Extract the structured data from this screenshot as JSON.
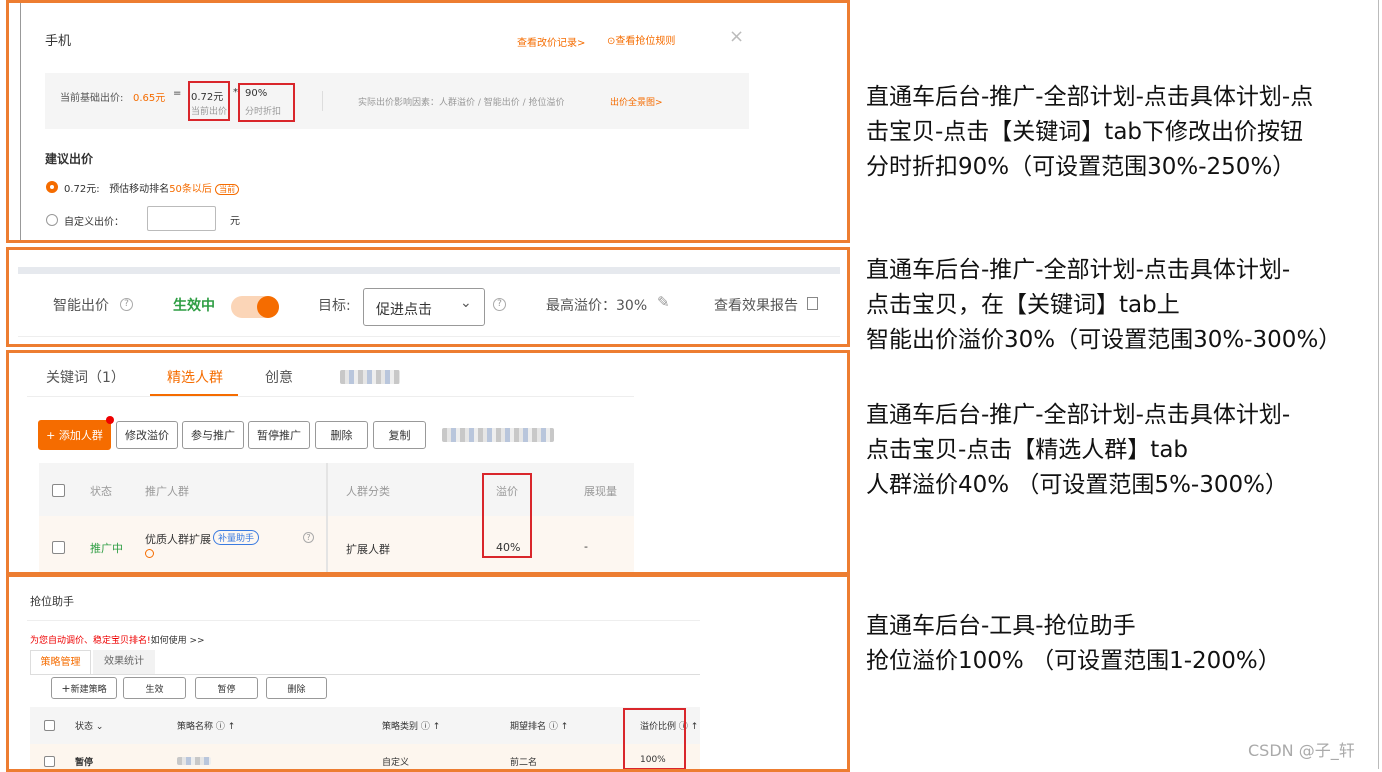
{
  "panel1": {
    "title": "手机",
    "link_history": "查看改价记录>",
    "link_rules": "查看抢位规则",
    "close": "×",
    "base_label": "当前基础出价:",
    "base_value": "0.65元",
    "equals": "=",
    "bid_value": "0.72元",
    "bid_caption": "当前出价",
    "multiply": "*",
    "discount_value": "90%",
    "discount_caption": "分时折扣",
    "factors": "实际出价影响因素：人群溢价 / 智能出价 / 抢位溢价",
    "factors_link": "出价全景图>",
    "suggest_title": "建议出价",
    "option1_value": "0.72元:",
    "option1_text": "预估移动排名",
    "option1_rank": "50条以后",
    "option1_badge": "当前",
    "option2_label": "自定义出价：",
    "option2_unit": "元"
  },
  "panel2": {
    "smart_label": "智能出价",
    "status": "生效中",
    "target_label": "目标:",
    "target_value": "促进点击",
    "max_premium": "最高溢价：30%",
    "report": "查看效果报告"
  },
  "panel3": {
    "tabs": [
      "关键词（1）",
      "精选人群",
      "创意"
    ],
    "buttons": {
      "add": "+ 添加人群",
      "modify": "修改溢价",
      "join": "参与推广",
      "pause": "暂停推广",
      "delete": "删除",
      "copy": "复制"
    },
    "headers": [
      "状态",
      "推广人群",
      "人群分类",
      "溢价",
      "展现量"
    ],
    "row": {
      "status": "推广中",
      "name": "优质人群扩展",
      "badge": "补量助手",
      "category": "扩展人群",
      "premium": "40%",
      "impressions": "-"
    }
  },
  "panel4": {
    "title": "抢位助手",
    "promo": "为您自动调价、稳定宝贝排名!",
    "howto": "如何使用 >>",
    "tabs": [
      "策略管理",
      "效果统计"
    ],
    "buttons": [
      "新建策略",
      "生效",
      "暂停",
      "删除"
    ],
    "headers": [
      "状态",
      "策略名称",
      "策略类别",
      "期望排名",
      "溢价比例"
    ],
    "row": {
      "status": "暂停",
      "type": "自定义",
      "rank": "前二名",
      "premium": "100%"
    }
  },
  "notes": {
    "n1": [
      "直通车后台-推广-全部计划-点击具体计划-点",
      "击宝贝-点击【关键词】tab下修改出价按钮",
      "分时折扣90%（可设置范围30%-250%）"
    ],
    "n2": [
      "直通车后台-推广-全部计划-点击具体计划-",
      "点击宝贝，在【关键词】tab上",
      "智能出价溢价30%（可设置范围30%-300%）"
    ],
    "n3": [
      "直通车后台-推广-全部计划-点击具体计划-",
      "点击宝贝-点击【精选人群】tab",
      "人群溢价40% （可设置范围5%-300%）"
    ],
    "n4": [
      "直通车后台-工具-抢位助手",
      "抢位溢价100% （可设置范围1-200%）"
    ]
  },
  "watermark": "CSDN @子_轩",
  "colors": {
    "frame": "#ED7D31",
    "highlight": "#d9262b",
    "accent": "#f56c00",
    "active": "#2f9e44"
  }
}
